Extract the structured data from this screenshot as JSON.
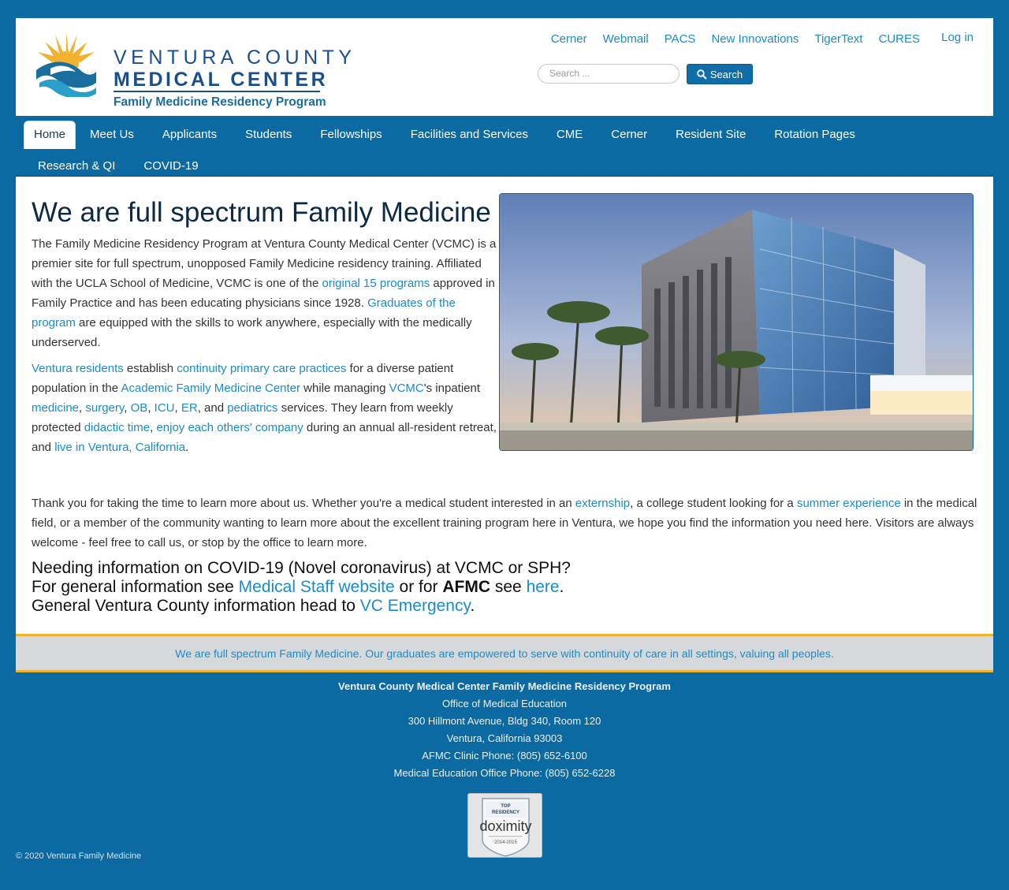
{
  "logo": {
    "line1": "VENTURA COUNTY",
    "line2": "MEDICAL CENTER",
    "line3": "Family Medicine Residency Program"
  },
  "toplinks": [
    "Cerner",
    "Webmail",
    "PACS",
    "New Innovations",
    "TigerText",
    "CURES"
  ],
  "login": "Log in",
  "search": {
    "placeholder": "Search ...",
    "button": "Search"
  },
  "nav": {
    "row1": [
      "Home",
      "Meet Us",
      "Applicants",
      "Students",
      "Fellowships",
      "Facilities and Services",
      "CME",
      "Cerner",
      "Resident Site",
      "Rotation Pages"
    ],
    "row2": [
      "Research & QI",
      "COVID-19"
    ]
  },
  "main": {
    "title": "We are full spectrum Family Medicine",
    "p1_a": "The Family Medicine Residency Program at Ventura County Medical Center (VCMC) is a premier site for full spectrum, unopposed Family Medicine residency training. Affiliated with the UCLA School of Medicine, VCMC is one of the ",
    "p1_link1": "original 15 programs",
    "p1_b": " approved in Family Practice and has been educating physicians since 1928. ",
    "p1_link2": "Graduates of the program",
    "p1_c": " are equipped with the skills to work anywhere, especially with the medically underserved.",
    "p2_link1": "Ventura residents",
    "p2_a": " establish ",
    "p2_link2": "continuity primary care practices",
    "p2_b": " for a diverse patient population in the ",
    "p2_link3": "Academic Family Medicine Center",
    "p2_c": " while managing ",
    "p2_link4": "VCMC",
    "p2_d": "'s inpatient ",
    "p2_link5": "medicine",
    "p2_sep1": ", ",
    "p2_link6": "surgery",
    "p2_sep2": ", ",
    "p2_link7": "OB",
    "p2_sep3": ", ",
    "p2_link8": "ICU",
    "p2_sep4": ", ",
    "p2_link9": "ER",
    "p2_e": ", and ",
    "p2_link10": "pediatrics",
    "p2_f": " services. They learn from weekly protected ",
    "p2_link11": "didactic time",
    "p2_sep5": ", ",
    "p2_link12": "enjoy each others' company",
    "p2_g": " during an annual all-resident retreat, and ",
    "p2_link13": "live in Ventura, California",
    "p2_h": ".",
    "p3_a": "Thank you for taking the time to learn more about us.  Whether you're a medical student interested in an ",
    "p3_link1": "externship",
    "p3_b": ", a college student looking for a ",
    "p3_link2": "summer experience",
    "p3_c": " in the medical field, or a member of the community wanting to learn more about the excellent training program here in Ventura, we hope you find the information you need here.  Visitors are always welcome - feel free to call us, or stop by the office to learn more."
  },
  "covid": {
    "line1": "Needing information on COVID-19 (Novel coronavirus) at VCMC or SPH?",
    "line2_a": "For general information see ",
    "line2_link1": "Medical Staff website",
    "line2_b": " or for ",
    "line2_bold": "AFMC",
    "line2_c": " see ",
    "line2_link2": "here",
    "line2_d": ".",
    "line3_a": "General Ventura County information head to ",
    "line3_link": "VC Emergency",
    "line3_b": "."
  },
  "tagline": "We are full spectrum Family Medicine. Our graduates are empowered to serve with continuity of care in all settings, valuing all peoples.",
  "footer": {
    "org": "Ventura County Medical Center Family Medicine Residency Program",
    "office": "Office of Medical Education",
    "address1": "300 Hillmont Avenue, Bldg 340, Room 120",
    "address2": "Ventura, California 93003",
    "phone1": "AFMC Clinic Phone: (805) 652-6100",
    "phone2": "Medical Education Office Phone: (805) 652-6228",
    "badge_top": "TOP RESIDENCY",
    "badge_brand": "doximity",
    "badge_years": "2014-2015",
    "copyright": "© 2020 Ventura Family Medicine"
  },
  "colors": {
    "brand_blue": "#0b6aa2",
    "link": "#1a8cc8",
    "accent_gold": "#f2b22f"
  }
}
